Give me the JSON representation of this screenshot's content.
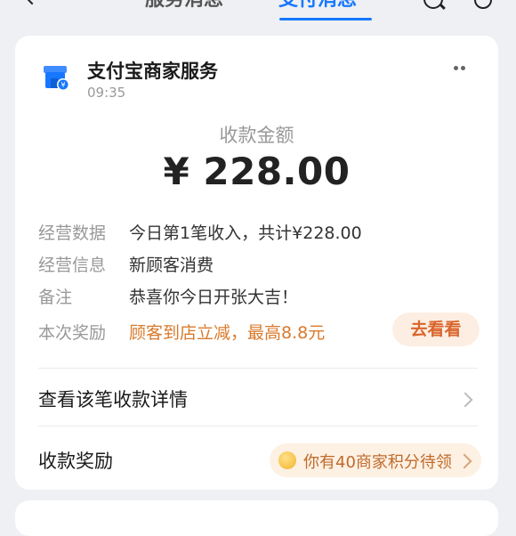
{
  "nav": {
    "tab_inactive": "服务消息",
    "tab_active": "支付消息"
  },
  "message": {
    "merchant_name": "支付宝商家服务",
    "time": "09:35",
    "amount_label": "收款金额",
    "amount": "¥ 228.00"
  },
  "details": [
    {
      "label": "经营数据",
      "value": "今日第1笔收入，共计¥228.00"
    },
    {
      "label": "经营信息",
      "value": "新顾客消费"
    },
    {
      "label": "备注",
      "value": "恭喜你今日开张大吉！"
    },
    {
      "label": "本次奖励",
      "value": "顾客到店立减，最高8.8元"
    }
  ],
  "goto_button": "去看看",
  "view_details": "查看该笔收款详情",
  "reward": {
    "label": "收款奖励",
    "points_text": "你有40商家积分待领"
  },
  "colors": {
    "accent": "#1677ff",
    "orange": "#d97a2b",
    "pill_bg": "#fdeee3"
  },
  "icons": [
    "chevron-left-icon",
    "search-icon",
    "settings-icon",
    "store-icon",
    "more-icon",
    "chevron-right-icon",
    "coin-icon"
  ]
}
